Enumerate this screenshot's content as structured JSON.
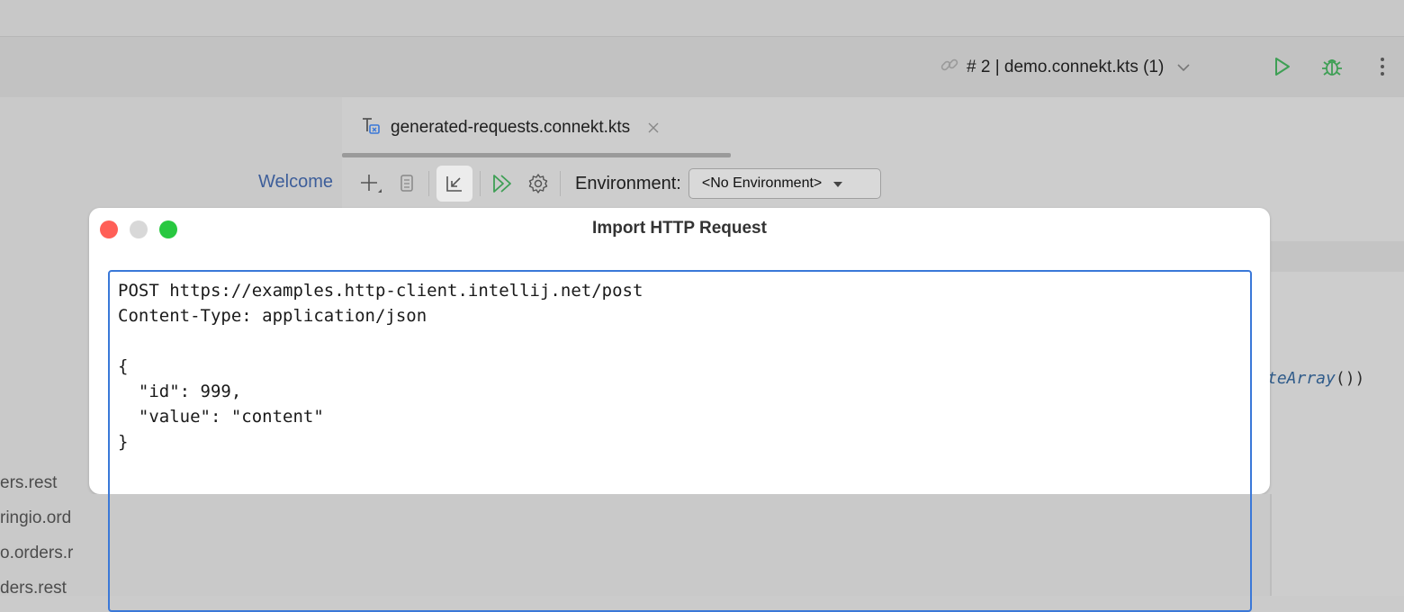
{
  "run_config": {
    "label": "# 2 | demo.connekt.kts (1)"
  },
  "left_pane": {
    "welcome": "Welcome",
    "files": [
      "ers.rest",
      "ringio.ord",
      "o.orders.r",
      "ders.rest"
    ]
  },
  "editor": {
    "tab_label": "generated-requests.connekt.kts",
    "environment_label": "Environment:",
    "environment_value": "<No Environment>",
    "code_fragment": {
      "italic": "teArray",
      "suffix": "())"
    }
  },
  "dialog": {
    "title": "Import HTTP Request",
    "request_text": "POST https://examples.http-client.intellij.net/post\nContent-Type: application/json\n\n{\n  \"id\": 999,\n  \"value\": \"content\"\n}"
  },
  "icons": [
    "link-icon",
    "chevron-down-icon",
    "run-icon",
    "debug-icon",
    "more-icon",
    "connekt-file-icon",
    "close-icon",
    "add-icon",
    "copy-icon",
    "import-icon",
    "run-all-icon",
    "gear-icon",
    "dropdown-caret-icon"
  ],
  "colors": {
    "accent": "#3a78d8",
    "run": "#3e9f55",
    "close": "#ff5f57",
    "minimize": "#d0d0d0",
    "maximize": "#28c840"
  }
}
